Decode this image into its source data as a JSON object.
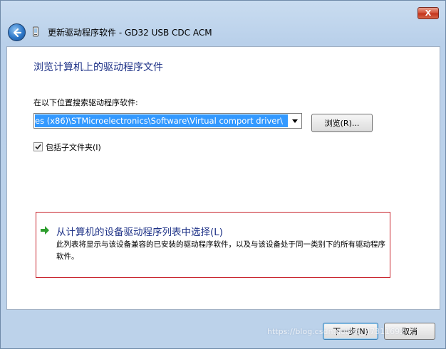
{
  "window": {
    "title": "更新驱动程序软件 - GD32 USB CDC ACM",
    "close_glyph": "X"
  },
  "content": {
    "heading": "浏览计算机上的驱动程序文件",
    "search_label": "在以下位置搜索驱动程序软件:",
    "path_value": "es (x86)\\STMicroelectronics\\Software\\Virtual comport driver\\",
    "browse_label": "浏览(R)...",
    "checkbox_label": "包括子文件夹(I)",
    "checkbox_checked": true
  },
  "pick_option": {
    "title": "从计算机的设备驱动程序列表中选择(L)",
    "description": "此列表将显示与该设备兼容的已安装的驱动程序软件，以及与该设备处于同一类别下的所有驱动程序软件。"
  },
  "footer": {
    "next_label": "下一步(N)",
    "cancel_label": "取消"
  },
  "watermark": "https://blog.csdn.net/qq_37311692",
  "colors": {
    "heading": "#1e3287",
    "highlight": "#3399ff",
    "pick_border": "#c8232c",
    "arrow_green": "#2e9e2e"
  }
}
